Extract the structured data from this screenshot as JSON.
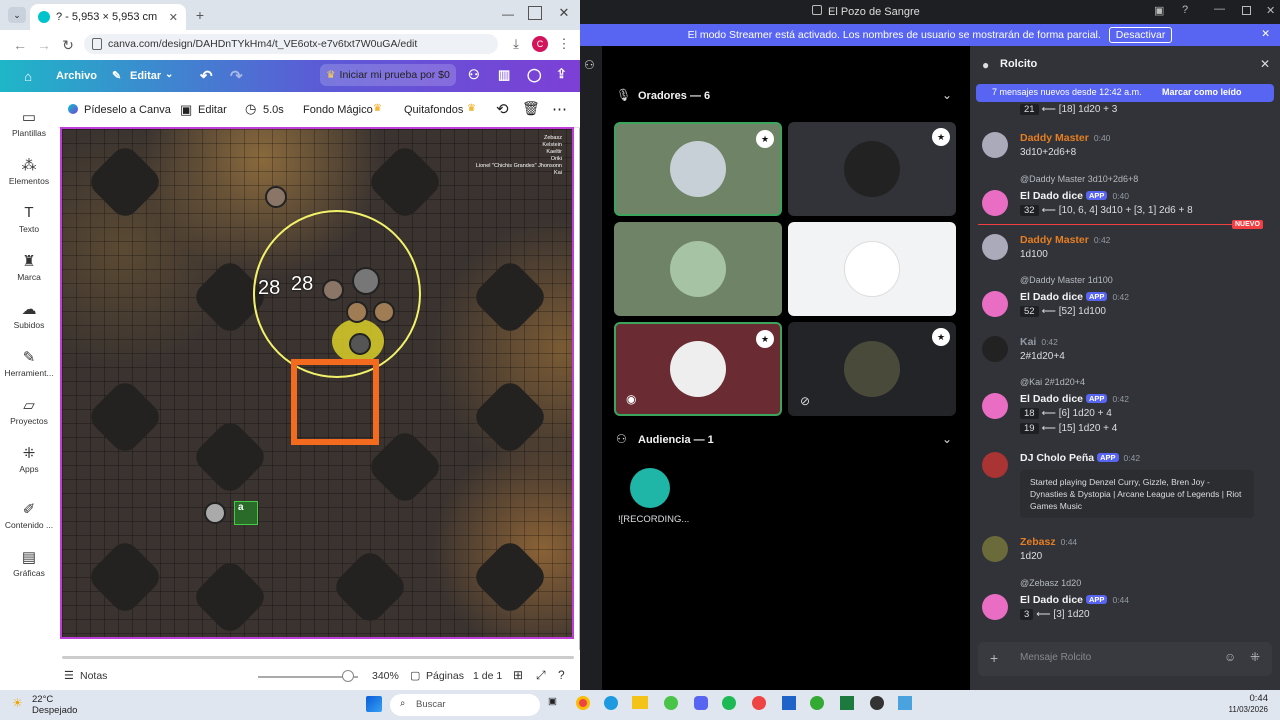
{
  "browser": {
    "tab_title": "? - 5,953 × 5,953 cm",
    "url": "canva.com/design/DAHDnTYkHm4/t_VE6otx-e7v6txt7W0uGA/edit"
  },
  "canva": {
    "menu": {
      "home_label": "Archivo",
      "edit_label": "Editar"
    },
    "trial_label": "Iniciar mi prueba por $0",
    "toolbar": {
      "ask_label": "Pídeselo a Canva",
      "edit_label": "Editar",
      "duration_label": "5.0s",
      "magic_bg_label": "Fondo Mágico",
      "remove_bg_label": "Quitafondos"
    },
    "sidebar": [
      {
        "label": "Plantillas",
        "icon": "layout-icon"
      },
      {
        "label": "Elementos",
        "icon": "elements-icon"
      },
      {
        "label": "Texto",
        "icon": "text-icon"
      },
      {
        "label": "Marca",
        "icon": "brand-icon"
      },
      {
        "label": "Subidos",
        "icon": "upload-icon"
      },
      {
        "label": "Herramient...",
        "icon": "tools-icon"
      },
      {
        "label": "Proyectos",
        "icon": "folder-icon"
      },
      {
        "label": "Apps",
        "icon": "apps-icon"
      },
      {
        "label": "Contenido ...",
        "icon": "content-icon"
      },
      {
        "label": "Gráficas",
        "icon": "chart-icon"
      }
    ],
    "canvas_names": [
      "Zebasz",
      "Kelstein",
      "Kaeltir",
      "Oriki",
      "Lionel \"Chichis Grandes\" Jhonsonn",
      "Kai"
    ],
    "token_label_a": "28",
    "token_label_b": "28",
    "token_a_letter": "a",
    "bottom": {
      "notes_label": "Notas",
      "zoom_label": "340%",
      "pages_label": "Páginas",
      "page_count": "1 de 1"
    }
  },
  "taskbar": {
    "weather_temp": "22°C",
    "weather_desc": "Despejado",
    "search_placeholder": "Buscar",
    "time": "0:44",
    "date": "11/03/2026"
  },
  "discord": {
    "window_title": "El Pozo de Sangre",
    "streamer_banner": "El modo Streamer está activado. Los nombres de usuario se mostrarán de forma parcial.",
    "deactivate_label": "Desactivar",
    "speakers_header": "Oradores — 6",
    "audience_header": "Audiencia — 1",
    "audience_member": "![RECORDING...",
    "channel_name": "Rolcito",
    "new_messages_banner": "7 mensajes nuevos desde 12:42 a.m.",
    "mark_read_label": "Marcar como leído",
    "new_divider_label": "NUEVO",
    "message_placeholder": "Mensaje Rolcito",
    "app_badge": "APP",
    "messages": {
      "top_result_num": "21",
      "top_result_text": "⟵ [18] 1d20 + 3",
      "m1_author": "Daddy Master",
      "m1_time": "0:40",
      "m1_text": "3d10+2d6+8",
      "m2_ref_author": "@Daddy Master",
      "m2_ref_text": "3d10+2d6+8",
      "m2_author": "El Dado dice",
      "m2_time": "0:40",
      "m2_num": "32",
      "m2_text": "⟵ [10, 6, 4] 3d10 + [3, 1] 2d6 + 8",
      "m3_author": "Daddy Master",
      "m3_time": "0:42",
      "m3_text": "1d100",
      "m4_ref_author": "@Daddy Master",
      "m4_ref_text": "1d100",
      "m4_author": "El Dado dice",
      "m4_time": "0:42",
      "m4_num": "52",
      "m4_text": "⟵ [52] 1d100",
      "m5_author": "Kai",
      "m5_time": "0:42",
      "m5_text": "2#1d20+4",
      "m6_ref_author": "@Kai",
      "m6_ref_text": "2#1d20+4",
      "m6_author": "El Dado dice",
      "m6_time": "0:42",
      "m6_num1": "18",
      "m6_text1": "⟵ [6] 1d20 + 4",
      "m6_num2": "19",
      "m6_text2": "⟵ [15] 1d20 + 4",
      "m7_author": "DJ Cholo Peña",
      "m7_time": "0:42",
      "m7_embed": "Started playing Denzel Curry, Gizzle, Bren Joy - Dynasties & Dystopia | Arcane League of Legends | Riot Games Music",
      "m8_author": "Zebasz",
      "m8_time": "0:44",
      "m8_text": "1d20",
      "m9_ref_author": "@Zebasz",
      "m9_ref_text": "1d20",
      "m9_author": "El Dado dice",
      "m9_time": "0:44",
      "m9_num": "3",
      "m9_text": "⟵ [3] 1d20"
    }
  },
  "colors": {
    "discord_blurple": "#5865f2",
    "canva_page_border": "#c13dd9",
    "highlight_box": "#f46a1f",
    "aoe_circle": "#f2f26a",
    "name_orange": "#e67e22",
    "new_red": "#f23f43"
  }
}
